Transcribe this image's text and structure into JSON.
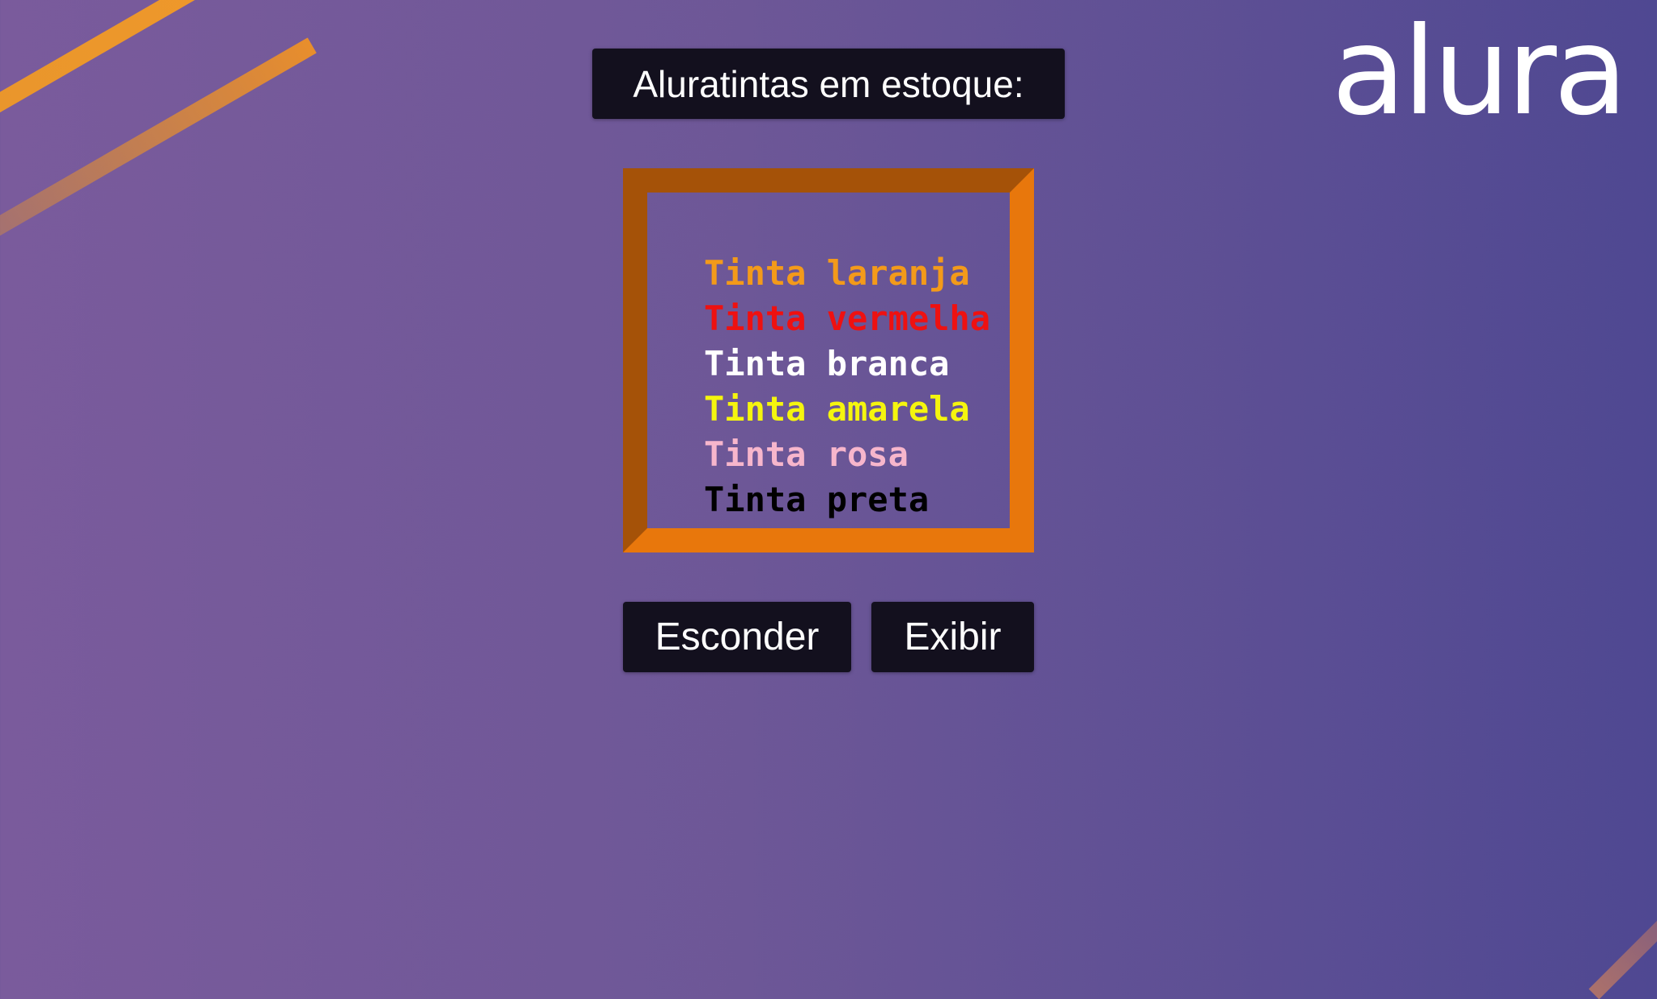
{
  "logo": {
    "text": "alura"
  },
  "header": {
    "title": "Aluratintas em estoque:"
  },
  "paints": [
    {
      "label": "Tinta laranja",
      "color": "#f39a1a"
    },
    {
      "label": "Tinta vermelha",
      "color": "#ee1111"
    },
    {
      "label": "Tinta branca",
      "color": "#ffffff"
    },
    {
      "label": "Tinta amarela",
      "color": "#f5f50e"
    },
    {
      "label": "Tinta rosa",
      "color": "#f7b6cc"
    },
    {
      "label": "Tinta preta",
      "color": "#000000"
    }
  ],
  "buttons": {
    "hide_label": "Esconder",
    "show_label": "Exibir"
  },
  "colors": {
    "accent_orange": "#e8770c",
    "dark_panel": "#13101e"
  }
}
